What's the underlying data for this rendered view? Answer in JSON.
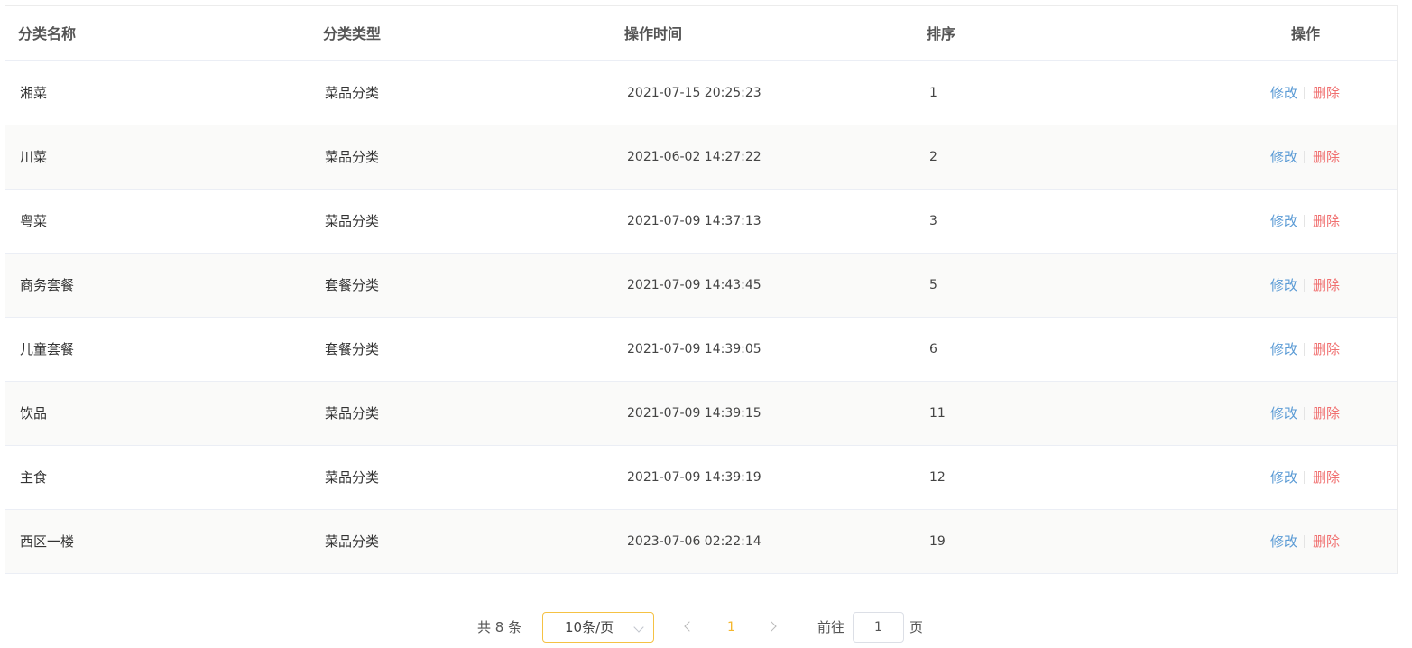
{
  "table": {
    "headers": {
      "name": "分类名称",
      "type": "分类类型",
      "time": "操作时间",
      "sort": "排序",
      "ops": "操作"
    },
    "rows": [
      {
        "name": "湘菜",
        "type": "菜品分类",
        "time": "2021-07-15 20:25:23",
        "sort": "1"
      },
      {
        "name": "川菜",
        "type": "菜品分类",
        "time": "2021-06-02 14:27:22",
        "sort": "2"
      },
      {
        "name": "粤菜",
        "type": "菜品分类",
        "time": "2021-07-09 14:37:13",
        "sort": "3"
      },
      {
        "name": "商务套餐",
        "type": "套餐分类",
        "time": "2021-07-09 14:43:45",
        "sort": "5"
      },
      {
        "name": "儿童套餐",
        "type": "套餐分类",
        "time": "2021-07-09 14:39:05",
        "sort": "6"
      },
      {
        "name": "饮品",
        "type": "菜品分类",
        "time": "2021-07-09 14:39:15",
        "sort": "11"
      },
      {
        "name": "主食",
        "type": "菜品分类",
        "time": "2021-07-09 14:39:19",
        "sort": "12"
      },
      {
        "name": "西区一楼",
        "type": "菜品分类",
        "time": "2023-07-06 02:22:14",
        "sort": "19"
      }
    ],
    "actions": {
      "edit": "修改",
      "delete": "删除"
    }
  },
  "pagination": {
    "total_text": "共 8 条",
    "page_size": "10条/页",
    "current_page": "1",
    "goto_label": "前往",
    "goto_value": "1",
    "page_suffix": "页"
  },
  "colors": {
    "edit_link": "#5b9bd5",
    "delete_link": "#f07070",
    "active_page": "#f5b72d",
    "select_border": "#f5c244"
  },
  "icons": {
    "select_arrow": "chevron-down-icon",
    "prev": "chevron-left-icon",
    "next": "chevron-right-icon"
  }
}
